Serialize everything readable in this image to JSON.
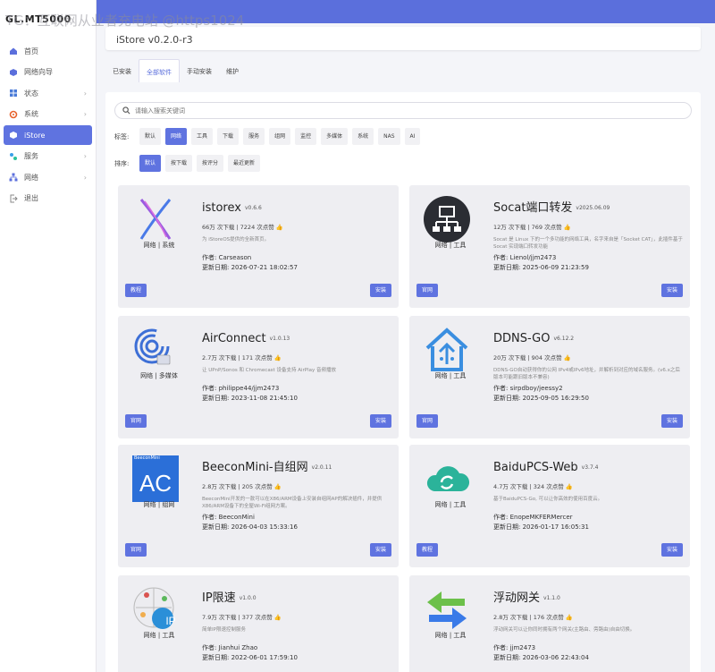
{
  "watermark": "TG：互联网从业者充电站 @https1024",
  "sidebar": {
    "logo": "GL.MT5000",
    "items": [
      {
        "label": "首页",
        "icon": "home-icon",
        "chevron": false,
        "active": false
      },
      {
        "label": "网络向导",
        "icon": "cube-icon",
        "chevron": false,
        "active": false
      },
      {
        "label": "状态",
        "icon": "grid-icon",
        "chevron": true,
        "active": false
      },
      {
        "label": "系统",
        "icon": "gear-icon",
        "chevron": true,
        "active": false
      },
      {
        "label": "iStore",
        "icon": "box-icon",
        "chevron": false,
        "active": true
      },
      {
        "label": "服务",
        "icon": "puzzle-icon",
        "chevron": true,
        "active": false
      },
      {
        "label": "网络",
        "icon": "network-icon",
        "chevron": true,
        "active": false
      },
      {
        "label": "退出",
        "icon": "logout-icon",
        "chevron": false,
        "active": false
      }
    ]
  },
  "header": {
    "title": "iStore v0.2.0-r3"
  },
  "tabs": [
    {
      "label": "已安装",
      "active": false
    },
    {
      "label": "全部软件",
      "active": true
    },
    {
      "label": "手动安装",
      "active": false
    },
    {
      "label": "维护",
      "active": false
    }
  ],
  "search": {
    "placeholder": "请输入搜索关键词"
  },
  "filters": {
    "tag_label": "标签:",
    "tags": [
      {
        "label": "默认",
        "active": false
      },
      {
        "label": "网络",
        "active": true
      },
      {
        "label": "工具",
        "active": false
      },
      {
        "label": "下载",
        "active": false
      },
      {
        "label": "服务",
        "active": false
      },
      {
        "label": "组网",
        "active": false
      },
      {
        "label": "监控",
        "active": false
      },
      {
        "label": "多媒体",
        "active": false
      },
      {
        "label": "系统",
        "active": false
      },
      {
        "label": "NAS",
        "active": false
      },
      {
        "label": "AI",
        "active": false
      }
    ],
    "sort_label": "排序:",
    "sorts": [
      {
        "label": "默认",
        "active": true
      },
      {
        "label": "按下载",
        "active": false
      },
      {
        "label": "按评分",
        "active": false
      },
      {
        "label": "最近更新",
        "active": false
      }
    ]
  },
  "apps": [
    {
      "name": "istorex",
      "version": "v0.6.6",
      "stats": "66万 次下载  |  7224 次点赞",
      "desc": "为 iStoreOS提供的全新首页。",
      "tags": "网络  |  系统",
      "author": "作者: Carseason",
      "updated": "更新日期: 2026-07-21 18:02:57",
      "btn_left": "教程",
      "btn_right": "安装",
      "icon": "istorex-logo-icon"
    },
    {
      "name": "Socat端口转发",
      "version": "v2025.06.09",
      "stats": "12万 次下载  |  769 次点赞",
      "desc": "Socat 是 Linux 下的一个多功能的网络工具，名字来自是「Socket CAT」，此插件基于 Socat 实现端口转发功能",
      "tags": "网络  |  工具",
      "author": "作者: Lienol/jjm2473",
      "updated": "更新日期: 2025-06-09 21:23:59",
      "btn_left": "官网",
      "btn_right": "安装",
      "icon": "socat-network-icon"
    },
    {
      "name": "AirConnect",
      "version": "v1.0.13",
      "stats": "2.7万 次下载  |  171 次点赞",
      "desc": "让 UPnP/Sonos 和 Chromecast 设备支持 AirPlay 音频播放",
      "tags": "网络  |  多媒体",
      "author": "作者: philippe44/jjm2473",
      "updated": "更新日期: 2023-11-08 21:45:10",
      "btn_left": "官网",
      "btn_right": "安装",
      "icon": "airconnect-icon"
    },
    {
      "name": "DDNS-GO",
      "version": "v6.12.2",
      "stats": "20万 次下载  |  904 次点赞",
      "desc": "DDNS-GO自动获得你的公网 IPv4或IPv6地址，并解析到对应的域名服务。(v6.x之后版本可能跟旧版本不兼容)",
      "tags": "网络  |  工具",
      "author": "作者: sirpdboy/jeessy2",
      "updated": "更新日期: 2025-09-05 16:29:50",
      "btn_left": "官网",
      "btn_right": "安装",
      "icon": "ddns-house-icon"
    },
    {
      "name": "BeeconMini-自组网",
      "version": "v2.0.11",
      "stats": "2.8万 次下载  |  205 次点赞",
      "desc": "BeeconMini开发的一款可以在X86/ARM设备上安装自组网AP的解决插件，并提供X86/ARM设备下的全屋Wi-Fi组网方案。",
      "tags": "网络  |  组网",
      "author": "作者: BeeconMini",
      "updated": "更新日期: 2026-04-03 15:33:16",
      "btn_left": "官网",
      "btn_right": "安装",
      "icon": "beecon-ac-icon",
      "icon_caption": "BeeconMini"
    },
    {
      "name": "BaiduPCS-Web",
      "version": "v3.7.4",
      "stats": "4.7万 次下载  |  324 次点赞",
      "desc": "基于BaiduPCS-Go, 可以让你高效的使用百度云。",
      "tags": "网络  |  工具",
      "author": "作者: EnopeMKFERMercer",
      "updated": "更新日期: 2026-01-17 16:05:31",
      "btn_left": "教程",
      "btn_right": "安装",
      "icon": "cloud-sync-icon"
    },
    {
      "name": "IP限速",
      "version": "v1.0.0",
      "stats": "7.9万 次下载  |  377 次点赞",
      "desc": "简单IP限速控制服务",
      "tags": "网络  |  工具",
      "author": "作者: Jianhui Zhao",
      "updated": "更新日期: 2022-06-01 17:59:10",
      "btn_left": "",
      "btn_right": "",
      "icon": "ip-globe-icon",
      "icon_caption": "IP"
    },
    {
      "name": "浮动网关",
      "version": "v1.1.0",
      "stats": "2.8万 次下载  |  176 次点赞",
      "desc": "浮动网关可以让你同时拥有两个网关(主路由、旁路由)自由切换。",
      "tags": "网络  |  工具",
      "author": "作者: jjm2473",
      "updated": "更新日期: 2026-03-06 22:43:04",
      "btn_left": "",
      "btn_right": "",
      "icon": "swap-arrows-icon"
    }
  ]
}
